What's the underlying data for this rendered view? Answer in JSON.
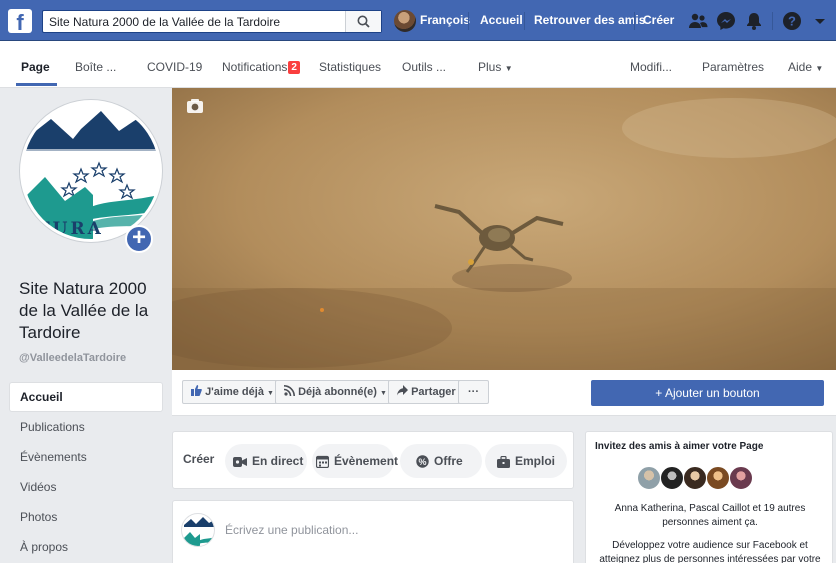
{
  "topbar": {
    "logo": "f",
    "search_value": "Site Natura 2000 de la Vallée de la Tardoire",
    "user_name": "François",
    "home": "Accueil",
    "find_friends": "Retrouver des amis",
    "create": "Créer",
    "icons": [
      "friends-icon",
      "messenger-icon",
      "notifications-bell-icon",
      "help-icon",
      "account-menu-arrow-icon"
    ]
  },
  "tabs": {
    "page": "Page",
    "inbox": "Boîte ...",
    "covid": "COVID-19",
    "notifications": "Notifications",
    "notifications_count": "2",
    "stats": "Statistiques",
    "tools": "Outils ...",
    "more": "Plus",
    "edit": "Modifi...",
    "settings": "Paramètres",
    "help": "Aide"
  },
  "sidebar": {
    "page_name": "Site Natura 2000 de la Vallée de la Tardoire",
    "handle": "@ValleedelaTardoire",
    "logo_text": "TURA",
    "items": [
      "Accueil",
      "Publications",
      "Évènements",
      "Vidéos",
      "Photos",
      "À propos"
    ]
  },
  "actions": {
    "like": "J'aime déjà",
    "follow": "Déjà abonné(e)",
    "share": "Partager",
    "more": "···",
    "add_button": "+ Ajouter un bouton"
  },
  "create": {
    "label": "Créer",
    "live": "En direct",
    "event": "Évènement",
    "offer": "Offre",
    "job": "Emploi"
  },
  "composer": {
    "placeholder": "Écrivez une publication..."
  },
  "invite": {
    "title": "Invitez des amis à aimer votre Page",
    "liked_by": "Anna Katherina, Pascal Caillot et 19 autres personnes aiment ça.",
    "promo": "Développez votre audience sur Facebook et atteignez plus de personnes intéressées par votre"
  },
  "colors": {
    "brand": "#4267b2",
    "badge": "#fa3e3e",
    "logo_teal": "#1e9a8f",
    "logo_navy": "#1a3f6b"
  }
}
